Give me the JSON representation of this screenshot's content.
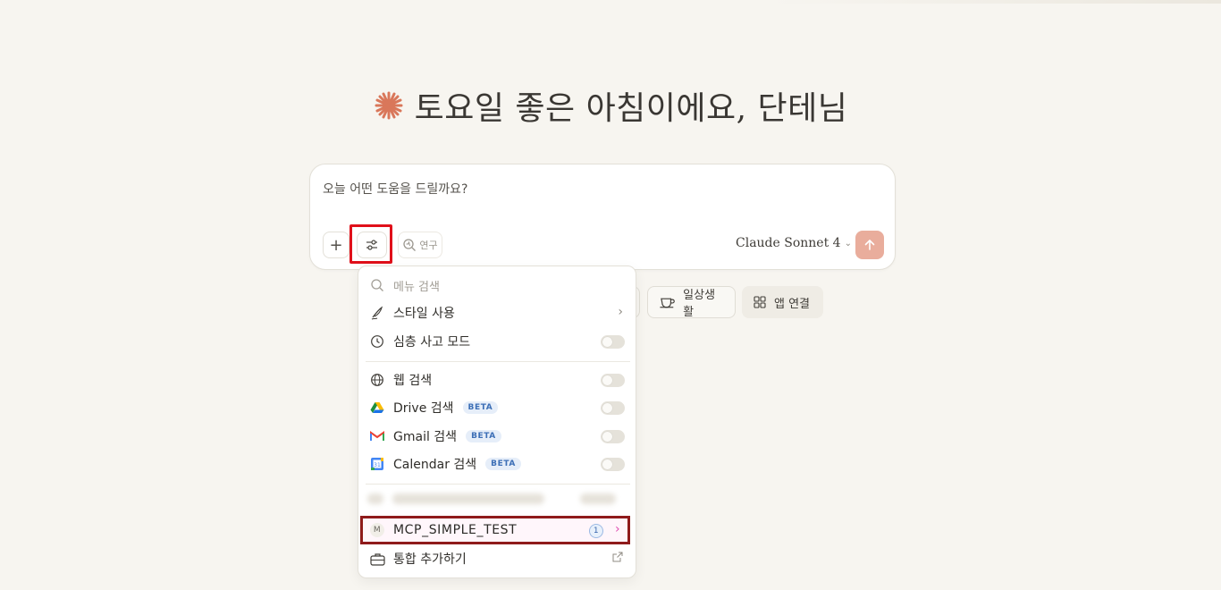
{
  "greeting": {
    "text": "토요일 좋은 아침이에요, 단테님",
    "spark_color": "#d9775a"
  },
  "composer": {
    "placeholder": "오늘 어떤 도움을 드릴까요?",
    "plus_label": "+",
    "research_label": "연구",
    "model_label": "Claude Sonnet 4",
    "send_color": "#e9ad9c"
  },
  "chips": [
    {
      "label": "일상생활",
      "icon": "coffee-icon"
    },
    {
      "label": "앱 연결",
      "icon": "grid-icon"
    }
  ],
  "menu": {
    "search_placeholder": "메뉴 검색",
    "style": {
      "label": "스타일 사용",
      "icon": "pen-icon"
    },
    "deep_think": {
      "label": "심층 사고 모드",
      "icon": "clock-icon"
    },
    "web_search": {
      "label": "웹 검색",
      "icon": "globe-icon"
    },
    "drive": {
      "label": "Drive 검색",
      "badge": "BETA",
      "icon": "drive-icon"
    },
    "gmail": {
      "label": "Gmail 검색",
      "badge": "BETA",
      "icon": "gmail-icon"
    },
    "calendar": {
      "label": "Calendar 검색",
      "badge": "BETA",
      "icon": "calendar-icon"
    },
    "mcp": {
      "label": "MCP_SIMPLE_TEST",
      "initial": "M",
      "count": "1"
    },
    "add_integration": {
      "label": "통합 추가하기",
      "icon": "briefcase-icon"
    }
  }
}
